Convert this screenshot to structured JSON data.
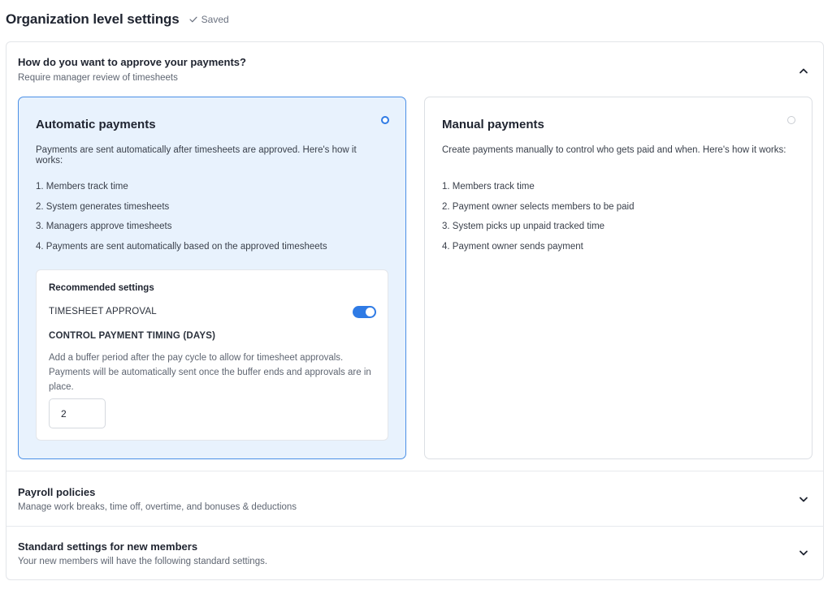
{
  "header": {
    "title": "Organization level settings",
    "status": "Saved"
  },
  "sections": {
    "approve": {
      "title": "How do you want to approve your payments?",
      "subtitle": "Require manager review of timesheets",
      "expanded": true
    },
    "payroll": {
      "title": "Payroll policies",
      "subtitle": "Manage work breaks, time off, overtime, and bonuses & deductions",
      "expanded": false
    },
    "standard": {
      "title": "Standard settings for new members",
      "subtitle": "Your new members will have the following standard settings.",
      "expanded": false
    }
  },
  "options": {
    "automatic": {
      "title": "Automatic payments",
      "selected": true,
      "description": "Payments are sent automatically after timesheets are approved. Here's how it works:",
      "steps": [
        "1. Members track time",
        "2. System generates timesheets",
        "3. Managers approve timesheets",
        "4. Payments are sent automatically based on the approved timesheets"
      ]
    },
    "manual": {
      "title": "Manual payments",
      "selected": false,
      "description": "Create payments manually to control who gets paid and when. Here's how it works:",
      "steps": [
        "1. Members track time",
        "2. Payment owner selects members to be paid",
        "3. System picks up unpaid tracked time",
        "4. Payment owner sends payment"
      ]
    }
  },
  "recommended": {
    "title": "Recommended settings",
    "timesheet_approval_label": "TIMESHEET APPROVAL",
    "timesheet_approval_on": true,
    "control_timing_label": "CONTROL PAYMENT TIMING (DAYS)",
    "buffer_description": "Add a buffer period after the pay cycle to allow for timesheet approvals. Payments will be automatically sent once the buffer ends and approvals are in place.",
    "days_value": "2"
  },
  "colors": {
    "accent": "#2f7be5",
    "selected_card_bg": "#e8f2fd",
    "selected_card_border": "#4a8fe6"
  },
  "icons": {
    "saved": "check-icon",
    "expanded": "chevron-up-icon",
    "collapsed": "chevron-down-icon"
  }
}
